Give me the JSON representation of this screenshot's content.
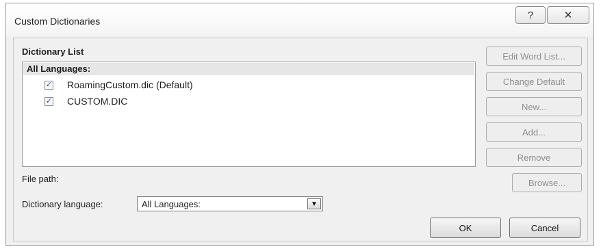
{
  "window": {
    "title": "Custom Dictionaries",
    "help_glyph": "?",
    "close_glyph": "✕"
  },
  "dictionary_list": {
    "label": "Dictionary List",
    "group_label": "All Languages:",
    "items": [
      {
        "name": "RoamingCustom.dic (Default)",
        "checked": true
      },
      {
        "name": "CUSTOM.DIC",
        "checked": true
      }
    ]
  },
  "buttons": {
    "edit_word_list": "Edit Word List...",
    "change_default": "Change Default",
    "new": "New...",
    "add": "Add...",
    "remove": "Remove",
    "browse": "Browse...",
    "ok": "OK",
    "cancel": "Cancel"
  },
  "file_path": {
    "label": "File path:"
  },
  "dictionary_language": {
    "label": "Dictionary language:",
    "selected": "All Languages:"
  },
  "icons": {
    "check": "✓",
    "dropdown": "▼"
  }
}
